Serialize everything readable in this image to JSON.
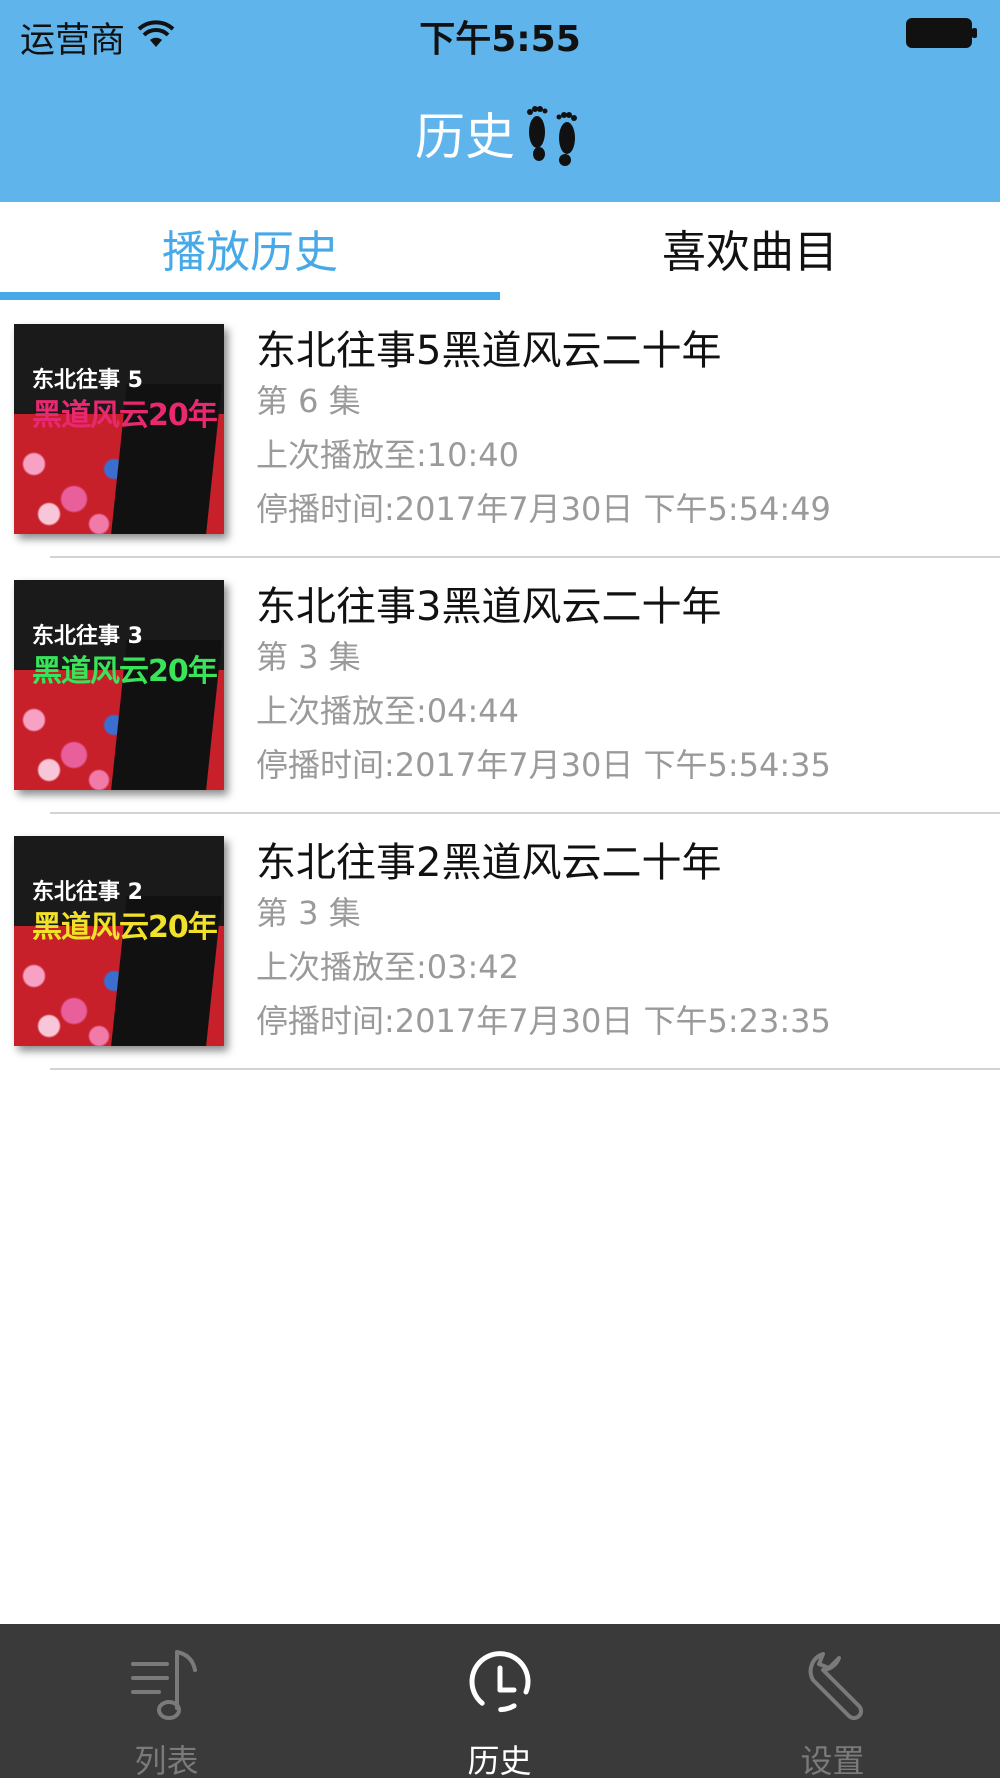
{
  "status_bar": {
    "carrier": "运营商",
    "time": "下午5:55"
  },
  "nav": {
    "title": "历史"
  },
  "tabs": [
    {
      "label": "播放历史",
      "active": true
    },
    {
      "label": "喜欢曲目",
      "active": false
    }
  ],
  "history": [
    {
      "title": "东北往事5黑道风云二十年",
      "episode": "第 6 集",
      "last_played": "上次播放至:10:40",
      "stop_time": "停播时间:2017年7月30日 下午5:54:49",
      "cover_title": "东北往事 5",
      "cover_subtitle": "黑道风云20年",
      "cover_accent": "#e8296f"
    },
    {
      "title": "东北往事3黑道风云二十年",
      "episode": "第 3 集",
      "last_played": "上次播放至:04:44",
      "stop_time": "停播时间:2017年7月30日 下午5:54:35",
      "cover_title": "东北往事 3",
      "cover_subtitle": "黑道风云20年",
      "cover_accent": "#39e45a"
    },
    {
      "title": "东北往事2黑道风云二十年",
      "episode": "第 3 集",
      "last_played": "上次播放至:03:42",
      "stop_time": "停播时间:2017年7月30日 下午5:23:35",
      "cover_title": "东北往事 2",
      "cover_subtitle": "黑道风云20年",
      "cover_accent": "#f2e12a"
    }
  ],
  "tabbar": [
    {
      "label": "列表",
      "icon": "music-list-icon",
      "active": false
    },
    {
      "label": "历史",
      "icon": "clock-icon",
      "active": true
    },
    {
      "label": "设置",
      "icon": "wrench-icon",
      "active": false
    }
  ],
  "colors": {
    "header": "#5fb4ec",
    "accent": "#47a9e8",
    "tabbar_bg": "#3a3a3a",
    "tabbar_active": "#ffffff",
    "tabbar_inactive": "#7a7a7a",
    "secondary_text": "#9a9a9a"
  }
}
